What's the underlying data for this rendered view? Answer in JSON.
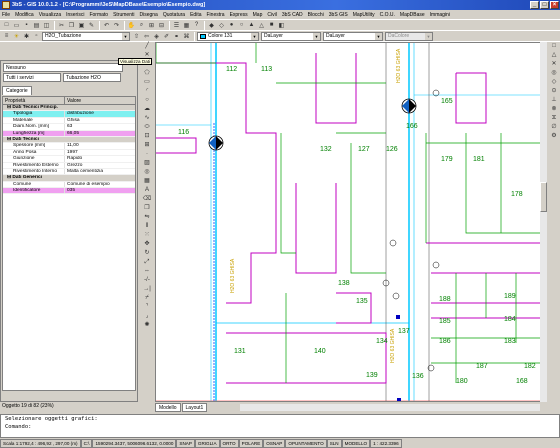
{
  "window": {
    "title": "3bS - GIS 10.0.1.2 - [C:\\Programmi\\3eS\\MapDBase\\Esempio\\Esempio.dwg]"
  },
  "menu": [
    "File",
    "Modifica",
    "Visualizza",
    "Inserisci",
    "Formato",
    "Strumenti",
    "Disegna",
    "Quotatura",
    "Edita",
    "Finestra",
    "Express",
    "Map",
    "Civil",
    "3bS CAD",
    "Blocchi",
    "3bS GIS",
    "MapUtility",
    "C.O.U.",
    "MapDBase",
    "Immagini"
  ],
  "toolbar": {
    "layer_combo": "H2O_Tubazione",
    "color_combo": "Colore 131",
    "linetype_combo": "DaLayer",
    "lineweight_combo": "DaLayer",
    "plotstyle_combo": "DaColore",
    "tooltip": "Visualizza Dati"
  },
  "panel": {
    "filter_combo": "Nessuno",
    "service_combo": "Tutti i servizi",
    "object_combo": "Tubazione H2O",
    "tab": "Categorie",
    "col_property": "Proprietà",
    "col_value": "Valore",
    "rows": [
      {
        "k": "Dati Tecnici Princip.",
        "v": "",
        "type": "group"
      },
      {
        "k": "Tipologia",
        "v": "distribuzione",
        "type": "cyan"
      },
      {
        "k": "Materiale",
        "v": "Ghisa",
        "type": ""
      },
      {
        "k": "Diam.Nom. [mm]",
        "v": "63",
        "type": ""
      },
      {
        "k": "Lunghezza [m]",
        "v": "66,05",
        "type": "pink"
      },
      {
        "k": "Dati Tecnici",
        "v": "",
        "type": "group"
      },
      {
        "k": "Spessore [mm]",
        "v": "11,00",
        "type": ""
      },
      {
        "k": "Anno Posa",
        "v": "1997",
        "type": ""
      },
      {
        "k": "Giunzione",
        "v": "Rapido",
        "type": ""
      },
      {
        "k": "Rivestimento Esterno",
        "v": "Grezzo",
        "type": ""
      },
      {
        "k": "Rivestimento Interno",
        "v": "Malta cementizia",
        "type": ""
      },
      {
        "k": "Dati Generici",
        "v": "",
        "type": "group"
      },
      {
        "k": "Comune",
        "v": "Comune di esempio",
        "type": ""
      },
      {
        "k": "Identificatore",
        "v": "035",
        "type": "pink"
      }
    ],
    "status": "Oggetto 19 di 82 (23%)"
  },
  "map": {
    "parcels": [
      "112",
      "113",
      "165",
      "166",
      "116",
      "132",
      "127",
      "126",
      "179",
      "181",
      "138",
      "135",
      "178",
      "137",
      "134",
      "188",
      "189",
      "185",
      "184",
      "131",
      "140",
      "186",
      "183",
      "187",
      "182",
      "136",
      "180",
      "168",
      "139"
    ],
    "pipe_labels": [
      "H2O 63 GHISA",
      "H2O 63 GHISA",
      "H2O 63 GHISA"
    ]
  },
  "model_tabs": [
    "Modello",
    "Layout1"
  ],
  "command": {
    "line1": "Selezionare oggetti grafici:",
    "line2": "Comando:"
  },
  "status": {
    "scale": "Scala 1:1792,4 : 496,92 , 297,00 (m)",
    "cs": "C:\\",
    "coords": "1590294.3437, 5006096.6132, 0.0000",
    "toggles": [
      "SNAP",
      "GRIGLIA",
      "ORTO",
      "POLARE",
      "OSNAP",
      "OPUNTAMENTO",
      "SLN",
      "MODELLO"
    ],
    "zoom": "1 : 422.3396"
  },
  "colors": {
    "titlebar": "#1f48b8",
    "parcel_green": "#00a000",
    "parcel_magenta": "#c000c0",
    "pipe_cyan": "#00c8ff"
  }
}
